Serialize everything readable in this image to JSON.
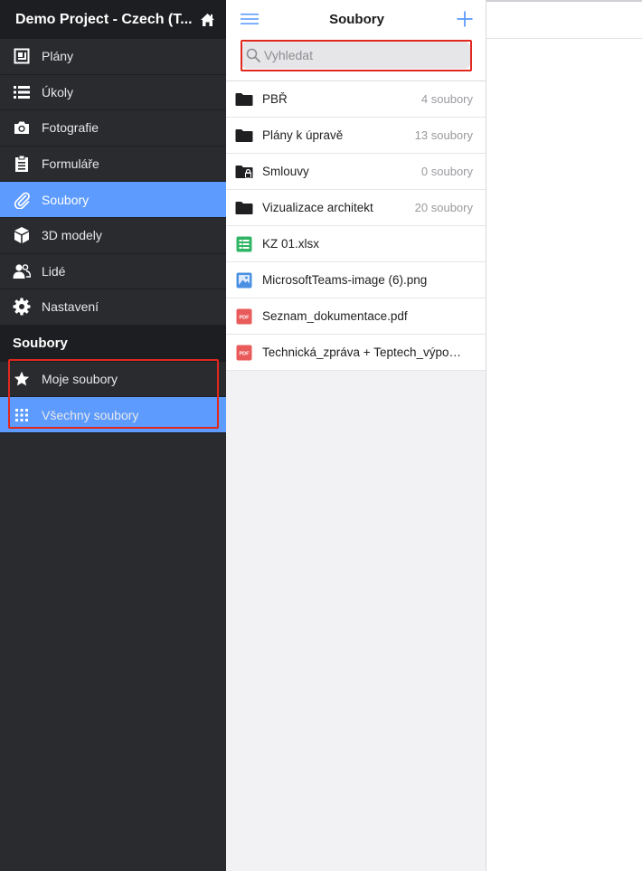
{
  "sidebar": {
    "project_title": "Demo Project - Czech (T...",
    "items": [
      {
        "label": "Plány",
        "icon": "plan-icon"
      },
      {
        "label": "Úkoly",
        "icon": "list-icon"
      },
      {
        "label": "Fotografie",
        "icon": "camera-icon"
      },
      {
        "label": "Formuláře",
        "icon": "clipboard-icon"
      },
      {
        "label": "Soubory",
        "icon": "paperclip-icon",
        "active": true
      },
      {
        "label": "3D modely",
        "icon": "cube-icon"
      },
      {
        "label": "Lidé",
        "icon": "people-icon"
      },
      {
        "label": "Nastavení",
        "icon": "gear-icon"
      }
    ],
    "section_title": "Soubory",
    "sub_items": [
      {
        "label": "Moje soubory",
        "icon": "star-icon"
      },
      {
        "label": "Všechny soubory",
        "icon": "grid-icon",
        "active": true
      }
    ]
  },
  "files_panel": {
    "title": "Soubory",
    "search_placeholder": "Vyhledat",
    "rows": [
      {
        "name": "PBŘ",
        "count": "4 soubory",
        "type": "folder"
      },
      {
        "name": "Plány k úpravě",
        "count": "13 soubory",
        "type": "folder"
      },
      {
        "name": "Smlouvy",
        "count": "0 soubory",
        "type": "folder-locked"
      },
      {
        "name": "Vizualizace architekt",
        "count": "20 soubory",
        "type": "folder"
      },
      {
        "name": "KZ 01.xlsx",
        "count": "",
        "type": "xlsx"
      },
      {
        "name": "MicrosoftTeams-image (6).png",
        "count": "",
        "type": "image"
      },
      {
        "name": "Seznam_dokumentace.pdf",
        "count": "",
        "type": "pdf"
      },
      {
        "name": "Technická_zpráva + Teptech_výpočet.pdf",
        "count": "",
        "type": "pdf"
      }
    ]
  },
  "colors": {
    "accent": "#5d9bff",
    "highlight": "#e0281f",
    "sidebar_bg": "#2a2b2f"
  }
}
